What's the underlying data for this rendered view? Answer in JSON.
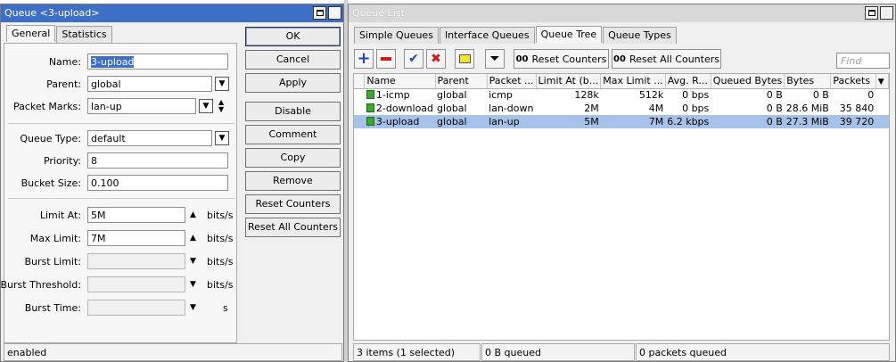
{
  "left_window": {
    "title": "Queue <3-upload>",
    "tabs": [
      {
        "label": "General"
      },
      {
        "label": "Statistics"
      }
    ],
    "fields": {
      "name": {
        "label": "Name:",
        "value": "3-upload"
      },
      "parent": {
        "label": "Parent:",
        "value": "global"
      },
      "packet_marks": {
        "label": "Packet Marks:",
        "value": "lan-up"
      },
      "queue_type": {
        "label": "Queue Type:",
        "value": "default"
      },
      "priority": {
        "label": "Priority:",
        "value": "8"
      },
      "bucket_size": {
        "label": "Bucket Size:",
        "value": "0.100"
      },
      "limit_at": {
        "label": "Limit At:",
        "value": "5M",
        "unit": "bits/s"
      },
      "max_limit": {
        "label": "Max Limit:",
        "value": "7M",
        "unit": "bits/s"
      },
      "burst_limit": {
        "label": "Burst Limit:",
        "value": "",
        "unit": "bits/s"
      },
      "burst_threshold": {
        "label": "Burst Threshold:",
        "value": "",
        "unit": "bits/s"
      },
      "burst_time": {
        "label": "Burst Time:",
        "value": "",
        "unit": "s"
      }
    },
    "buttons": {
      "ok": "OK",
      "cancel": "Cancel",
      "apply": "Apply",
      "disable": "Disable",
      "comment": "Comment",
      "copy": "Copy",
      "remove": "Remove",
      "reset_counters": "Reset Counters",
      "reset_all_counters": "Reset All Counters"
    },
    "status": "enabled"
  },
  "right_window": {
    "title": "Queue List",
    "tabs": [
      {
        "label": "Simple Queues"
      },
      {
        "label": "Interface Queues"
      },
      {
        "label": "Queue Tree"
      },
      {
        "label": "Queue Types"
      }
    ],
    "toolbar": {
      "reset_counters": "Reset Counters",
      "reset_all_counters": "Reset All Counters",
      "oo": "00",
      "find_placeholder": "Find"
    },
    "columns": [
      "Name",
      "Parent",
      "Packet ...",
      "Limit At (b...",
      "Max Limit ...",
      "Avg. R...",
      "Queued Bytes",
      "Bytes",
      "Packets"
    ],
    "rows": [
      {
        "name": "1-icmp",
        "parent": "global",
        "packet_marks": "icmp",
        "limit_at": "128k",
        "max_limit": "512k",
        "avg_rate": "0 bps",
        "queued_bytes": "0 B",
        "bytes": "0 B",
        "packets": "0"
      },
      {
        "name": "2-download",
        "parent": "global",
        "packet_marks": "lan-down",
        "limit_at": "2M",
        "max_limit": "4M",
        "avg_rate": "0 bps",
        "queued_bytes": "0 B",
        "bytes": "28.6 MiB",
        "packets": "35 840"
      },
      {
        "name": "3-upload",
        "parent": "global",
        "packet_marks": "lan-up",
        "limit_at": "5M",
        "max_limit": "7M",
        "avg_rate": "6.2 kbps",
        "queued_bytes": "0 B",
        "bytes": "27.3 MiB",
        "packets": "39 720"
      }
    ],
    "status": {
      "items": "3 items (1 selected)",
      "queued": "0 B queued",
      "packets_queued": "0 packets queued"
    }
  },
  "colors": {
    "accent": "#3d6fc6",
    "selected_row": "#a6c2e8",
    "queue_icon": "#3aaa2e"
  }
}
